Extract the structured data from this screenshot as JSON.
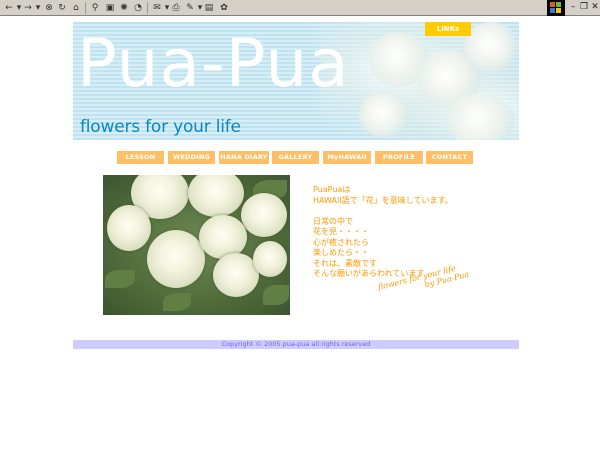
{
  "browser": {
    "toolbar_icons": [
      "back-icon",
      "forward-icon",
      "stop-icon",
      "refresh-icon",
      "home-icon",
      "search-icon",
      "favorites-icon",
      "media-icon",
      "history-icon",
      "mail-icon",
      "print-icon",
      "edit-icon",
      "discuss-icon",
      "messenger-icon"
    ],
    "window_controls": [
      "minimize",
      "maximize",
      "close"
    ]
  },
  "banner": {
    "title": "Pua-Pua",
    "subtitle": "flowers for your life",
    "links_label": "LINKs"
  },
  "nav": {
    "items": [
      {
        "label": "LESSON"
      },
      {
        "label": "WEDDING"
      },
      {
        "label": "HANA DIARY"
      },
      {
        "label": "GALLERY"
      },
      {
        "label": "MyHAWAII"
      },
      {
        "label": "PROFILE"
      },
      {
        "label": "CONTACT"
      }
    ]
  },
  "content": {
    "lines_1": [
      "PuaPuaは",
      "HAWAII語で「花」を意味しています。"
    ],
    "lines_2": [
      "日常の中で",
      "花を見・・・・",
      "心が癒されたら",
      "楽しめたら・・",
      "それは、素敵です",
      "そんな願いがあらわれています"
    ],
    "signature_line1": "flowers for your life",
    "signature_line2": "by Pua-Pua"
  },
  "footer": {
    "copyright": "Copyright © 2005 pua-pua all rights reserved"
  },
  "colors": {
    "accent_orange": "#ff9900",
    "nav_bg": "#ffbf66",
    "links_bg": "#ffcc00",
    "banner_blue": "#0a86c4",
    "footer_bg": "#ccccff",
    "footer_text": "#7a5cff"
  }
}
